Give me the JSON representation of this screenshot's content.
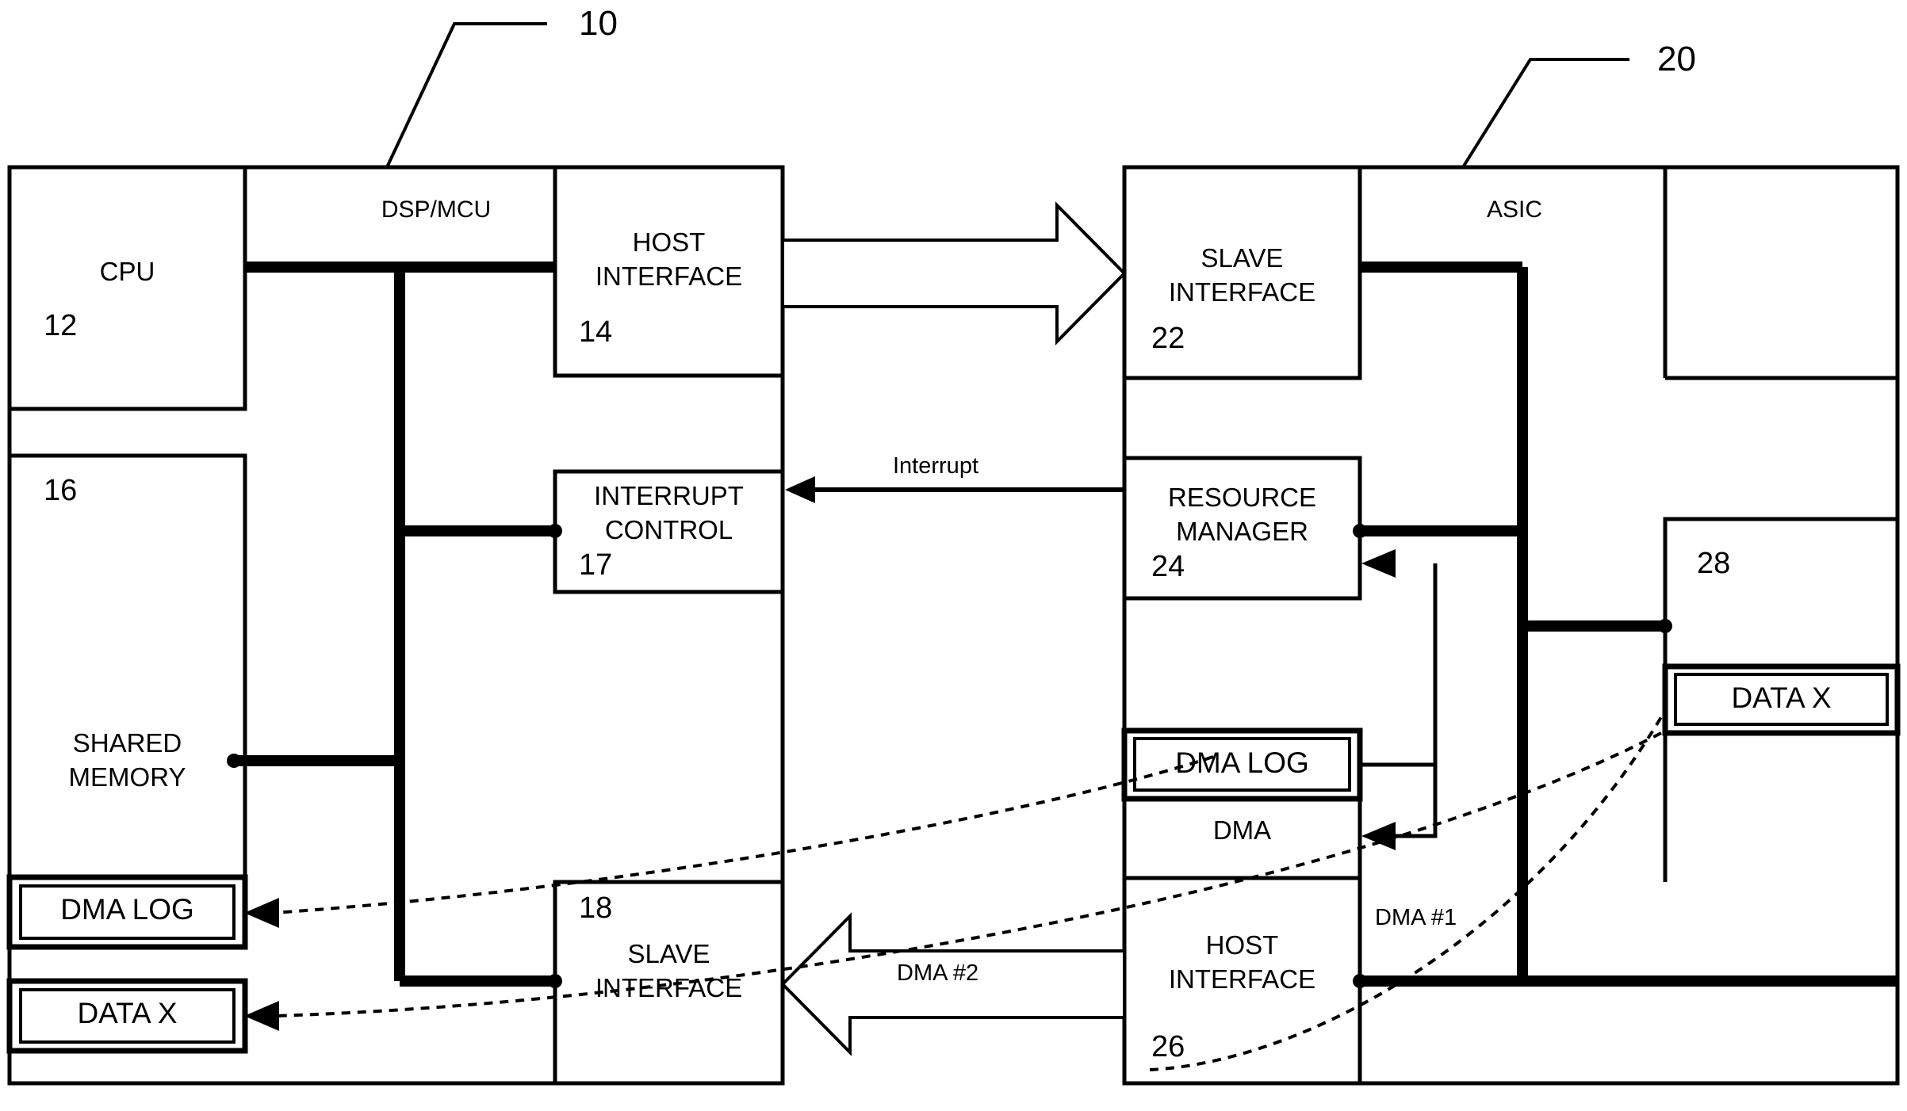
{
  "figure": {
    "type": "patent-block-diagram",
    "background": "#ffffff",
    "line_color": "#000000"
  },
  "left_system": {
    "title": "DSP/MCU",
    "ref": "10",
    "blocks": {
      "cpu": {
        "label": "CPU",
        "ref": "12"
      },
      "shared_memory": {
        "label_line1": "SHARED",
        "label_line2": "MEMORY",
        "ref": "16"
      },
      "host_interface": {
        "label_line1": "HOST",
        "label_line2": "INTERFACE",
        "ref": "14"
      },
      "interrupt_control": {
        "label_line1": "INTERRUPT",
        "label_line2": "CONTROL",
        "ref": "17"
      },
      "slave_interface": {
        "label_line1": "SLAVE",
        "label_line2": "INTERFACE",
        "ref": "18"
      }
    },
    "memory_items": [
      {
        "label": "DMA LOG"
      },
      {
        "label": "DATA X"
      }
    ]
  },
  "right_system": {
    "title": "ASIC",
    "ref": "20",
    "blocks": {
      "slave_interface": {
        "label_line1": "SLAVE",
        "label_line2": "INTERFACE",
        "ref": "22"
      },
      "resource_manager": {
        "label_line1": "RESOURCE",
        "label_line2": "MANAGER",
        "ref": "24"
      },
      "host_interface": {
        "label_line1": "HOST",
        "label_line2": "INTERFACE",
        "ref": "26"
      },
      "dma": {
        "label": "DMA"
      },
      "memory": {
        "ref": "28"
      }
    },
    "memory_items": [
      {
        "label": "DMA LOG"
      },
      {
        "label": "DATA X"
      }
    ]
  },
  "connectors": {
    "interrupt": "Interrupt",
    "dma1": "DMA #1",
    "dma2": "DMA #2"
  }
}
